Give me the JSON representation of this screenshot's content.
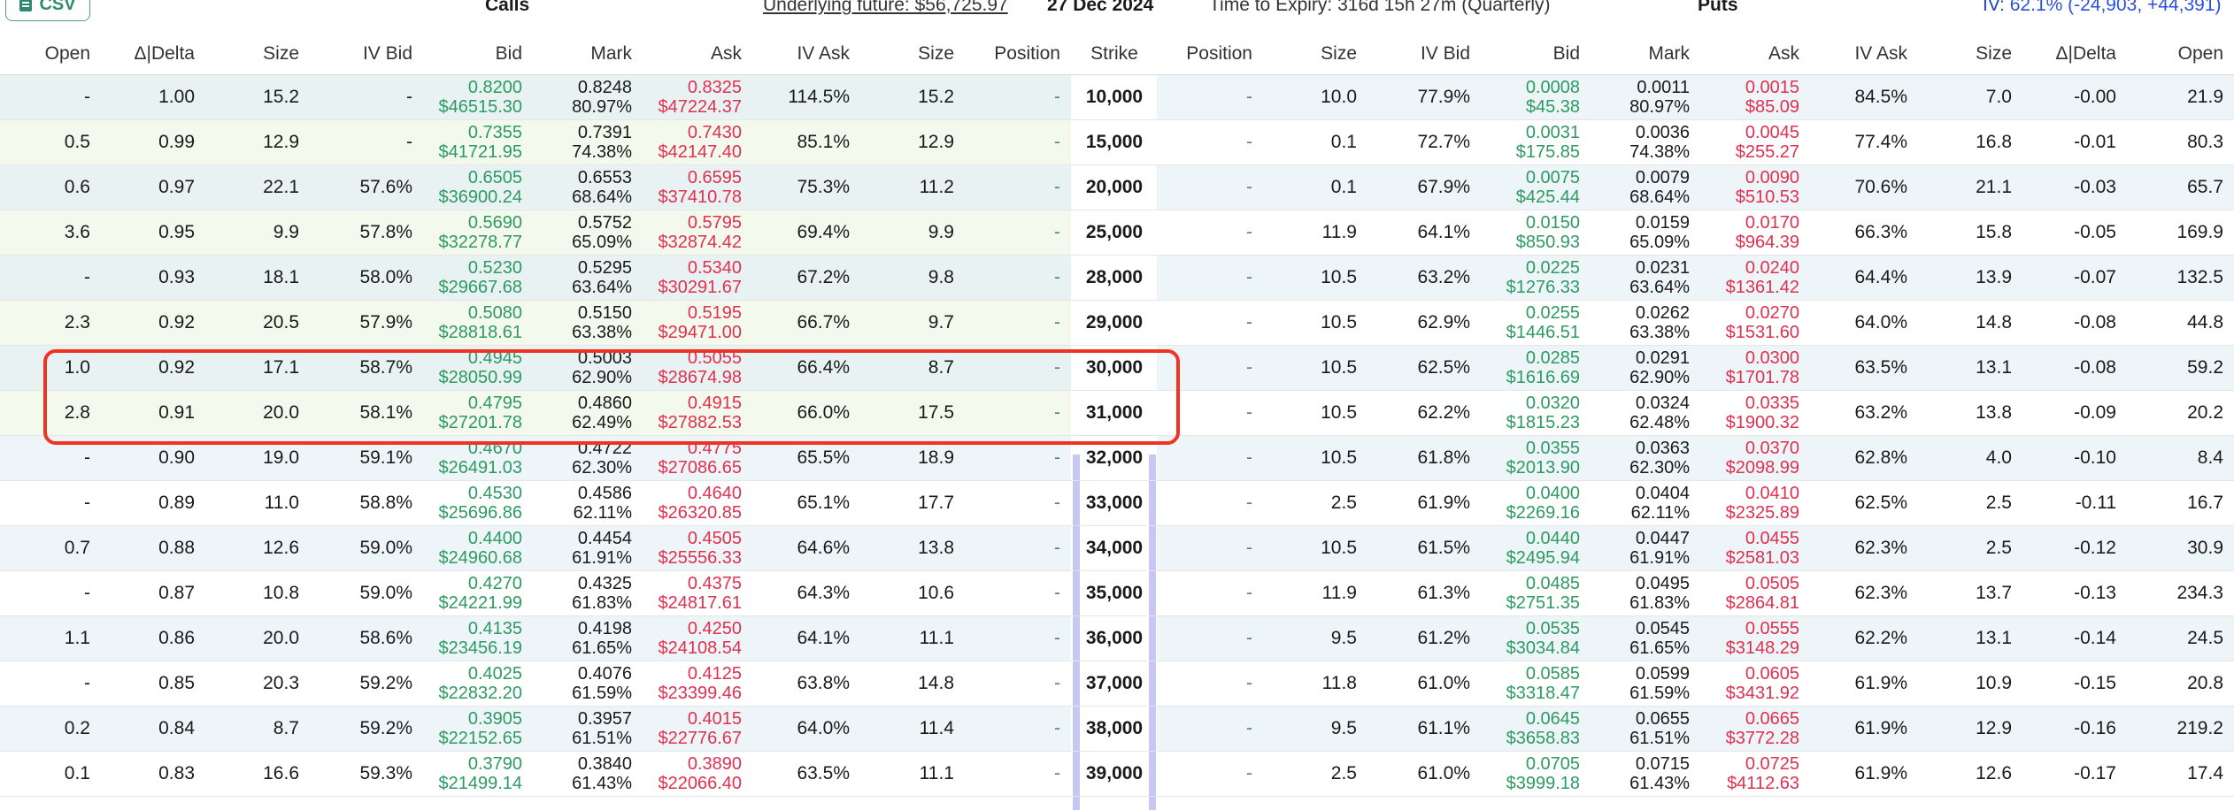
{
  "toolbar": {
    "csv_label": "CSV",
    "calls_title": "Calls",
    "underlying_future": "Underlying future: $56,725.97",
    "expiry_date": "27 Dec 2024",
    "time_to_expiry": "Time to Expiry: 316d 15h 27m (Quarterly)",
    "puts_title": "Puts",
    "iv_label": "IV:",
    "iv_value": "62.1% (-24,903, +44,391)"
  },
  "columns": {
    "calls": [
      "Open",
      "Δ|Delta",
      "Size",
      "IV Bid",
      "Bid",
      "Mark",
      "Ask",
      "IV Ask",
      "Size",
      "Position"
    ],
    "strike": "Strike",
    "puts": [
      "Position",
      "Size",
      "IV Bid",
      "Bid",
      "Mark",
      "Ask",
      "IV Ask",
      "Size",
      "Δ|Delta",
      "Open"
    ]
  },
  "rows": [
    {
      "strike": "10,000",
      "calls": {
        "open": "-",
        "delta": "1.00",
        "size": "15.2",
        "iv_bid": "-",
        "bid": "0.8200",
        "bid_usd": "$46515.30",
        "mark": "0.8248",
        "mark_pct": "80.97%",
        "ask": "0.8325",
        "ask_usd": "$47224.37",
        "iv_ask": "114.5%",
        "ask_size": "15.2",
        "position": "-"
      },
      "puts": {
        "position": "-",
        "size": "10.0",
        "iv_bid": "77.9%",
        "bid": "0.0008",
        "bid_usd": "$45.38",
        "mark": "0.0011",
        "mark_pct": "80.97%",
        "ask": "0.0015",
        "ask_usd": "$85.09",
        "iv_ask": "84.5%",
        "ask_size": "7.0",
        "delta": "-0.00",
        "open": "21.9"
      }
    },
    {
      "strike": "15,000",
      "calls": {
        "open": "0.5",
        "delta": "0.99",
        "size": "12.9",
        "iv_bid": "-",
        "bid": "0.7355",
        "bid_usd": "$41721.95",
        "mark": "0.7391",
        "mark_pct": "74.38%",
        "ask": "0.7430",
        "ask_usd": "$42147.40",
        "iv_ask": "85.1%",
        "ask_size": "12.9",
        "position": "-"
      },
      "puts": {
        "position": "-",
        "size": "0.1",
        "iv_bid": "72.7%",
        "bid": "0.0031",
        "bid_usd": "$175.85",
        "mark": "0.0036",
        "mark_pct": "74.38%",
        "ask": "0.0045",
        "ask_usd": "$255.27",
        "iv_ask": "77.4%",
        "ask_size": "16.8",
        "delta": "-0.01",
        "open": "80.3"
      }
    },
    {
      "strike": "20,000",
      "calls": {
        "open": "0.6",
        "delta": "0.97",
        "size": "22.1",
        "iv_bid": "57.6%",
        "bid": "0.6505",
        "bid_usd": "$36900.24",
        "mark": "0.6553",
        "mark_pct": "68.64%",
        "ask": "0.6595",
        "ask_usd": "$37410.78",
        "iv_ask": "75.3%",
        "ask_size": "11.2",
        "position": "-"
      },
      "puts": {
        "position": "-",
        "size": "0.1",
        "iv_bid": "67.9%",
        "bid": "0.0075",
        "bid_usd": "$425.44",
        "mark": "0.0079",
        "mark_pct": "68.64%",
        "ask": "0.0090",
        "ask_usd": "$510.53",
        "iv_ask": "70.6%",
        "ask_size": "21.1",
        "delta": "-0.03",
        "open": "65.7"
      }
    },
    {
      "strike": "25,000",
      "calls": {
        "open": "3.6",
        "delta": "0.95",
        "size": "9.9",
        "iv_bid": "57.8%",
        "bid": "0.5690",
        "bid_usd": "$32278.77",
        "mark": "0.5752",
        "mark_pct": "65.09%",
        "ask": "0.5795",
        "ask_usd": "$32874.42",
        "iv_ask": "69.4%",
        "ask_size": "9.9",
        "position": "-"
      },
      "puts": {
        "position": "-",
        "size": "11.9",
        "iv_bid": "64.1%",
        "bid": "0.0150",
        "bid_usd": "$850.93",
        "mark": "0.0159",
        "mark_pct": "65.09%",
        "ask": "0.0170",
        "ask_usd": "$964.39",
        "iv_ask": "66.3%",
        "ask_size": "15.8",
        "delta": "-0.05",
        "open": "169.9"
      }
    },
    {
      "strike": "28,000",
      "calls": {
        "open": "-",
        "delta": "0.93",
        "size": "18.1",
        "iv_bid": "58.0%",
        "bid": "0.5230",
        "bid_usd": "$29667.68",
        "mark": "0.5295",
        "mark_pct": "63.64%",
        "ask": "0.5340",
        "ask_usd": "$30291.67",
        "iv_ask": "67.2%",
        "ask_size": "9.8",
        "position": "-"
      },
      "puts": {
        "position": "-",
        "size": "10.5",
        "iv_bid": "63.2%",
        "bid": "0.0225",
        "bid_usd": "$1276.33",
        "mark": "0.0231",
        "mark_pct": "63.64%",
        "ask": "0.0240",
        "ask_usd": "$1361.42",
        "iv_ask": "64.4%",
        "ask_size": "13.9",
        "delta": "-0.07",
        "open": "132.5"
      }
    },
    {
      "strike": "29,000",
      "calls": {
        "open": "2.3",
        "delta": "0.92",
        "size": "20.5",
        "iv_bid": "57.9%",
        "bid": "0.5080",
        "bid_usd": "$28818.61",
        "mark": "0.5150",
        "mark_pct": "63.38%",
        "ask": "0.5195",
        "ask_usd": "$29471.00",
        "iv_ask": "66.7%",
        "ask_size": "9.7",
        "position": "-"
      },
      "puts": {
        "position": "-",
        "size": "10.5",
        "iv_bid": "62.9%",
        "bid": "0.0255",
        "bid_usd": "$1446.51",
        "mark": "0.0262",
        "mark_pct": "63.38%",
        "ask": "0.0270",
        "ask_usd": "$1531.60",
        "iv_ask": "64.0%",
        "ask_size": "14.8",
        "delta": "-0.08",
        "open": "44.8"
      }
    },
    {
      "strike": "30,000",
      "calls": {
        "open": "1.0",
        "delta": "0.92",
        "size": "17.1",
        "iv_bid": "58.7%",
        "bid": "0.4945",
        "bid_usd": "$28050.99",
        "mark": "0.5003",
        "mark_pct": "62.90%",
        "ask": "0.5055",
        "ask_usd": "$28674.98",
        "iv_ask": "66.4%",
        "ask_size": "8.7",
        "position": "-"
      },
      "puts": {
        "position": "-",
        "size": "10.5",
        "iv_bid": "62.5%",
        "bid": "0.0285",
        "bid_usd": "$1616.69",
        "mark": "0.0291",
        "mark_pct": "62.90%",
        "ask": "0.0300",
        "ask_usd": "$1701.78",
        "iv_ask": "63.5%",
        "ask_size": "13.1",
        "delta": "-0.08",
        "open": "59.2"
      }
    },
    {
      "strike": "31,000",
      "calls": {
        "open": "2.8",
        "delta": "0.91",
        "size": "20.0",
        "iv_bid": "58.1%",
        "bid": "0.4795",
        "bid_usd": "$27201.78",
        "mark": "0.4860",
        "mark_pct": "62.49%",
        "ask": "0.4915",
        "ask_usd": "$27882.53",
        "iv_ask": "66.0%",
        "ask_size": "17.5",
        "position": "-"
      },
      "puts": {
        "position": "-",
        "size": "10.5",
        "iv_bid": "62.2%",
        "bid": "0.0320",
        "bid_usd": "$1815.23",
        "mark": "0.0324",
        "mark_pct": "62.48%",
        "ask": "0.0335",
        "ask_usd": "$1900.32",
        "iv_ask": "63.2%",
        "ask_size": "13.8",
        "delta": "-0.09",
        "open": "20.2"
      }
    },
    {
      "strike": "32,000",
      "calls": {
        "open": "-",
        "delta": "0.90",
        "size": "19.0",
        "iv_bid": "59.1%",
        "bid": "0.4670",
        "bid_usd": "$26491.03",
        "mark": "0.4722",
        "mark_pct": "62.30%",
        "ask": "0.4775",
        "ask_usd": "$27086.65",
        "iv_ask": "65.5%",
        "ask_size": "18.9",
        "position": "-"
      },
      "puts": {
        "position": "-",
        "size": "10.5",
        "iv_bid": "61.8%",
        "bid": "0.0355",
        "bid_usd": "$2013.90",
        "mark": "0.0363",
        "mark_pct": "62.30%",
        "ask": "0.0370",
        "ask_usd": "$2098.99",
        "iv_ask": "62.8%",
        "ask_size": "4.0",
        "delta": "-0.10",
        "open": "8.4"
      }
    },
    {
      "strike": "33,000",
      "calls": {
        "open": "-",
        "delta": "0.89",
        "size": "11.0",
        "iv_bid": "58.8%",
        "bid": "0.4530",
        "bid_usd": "$25696.86",
        "mark": "0.4586",
        "mark_pct": "62.11%",
        "ask": "0.4640",
        "ask_usd": "$26320.85",
        "iv_ask": "65.1%",
        "ask_size": "17.7",
        "position": "-"
      },
      "puts": {
        "position": "-",
        "size": "2.5",
        "iv_bid": "61.9%",
        "bid": "0.0400",
        "bid_usd": "$2269.16",
        "mark": "0.0404",
        "mark_pct": "62.11%",
        "ask": "0.0410",
        "ask_usd": "$2325.89",
        "iv_ask": "62.5%",
        "ask_size": "2.5",
        "delta": "-0.11",
        "open": "16.7"
      }
    },
    {
      "strike": "34,000",
      "calls": {
        "open": "0.7",
        "delta": "0.88",
        "size": "12.6",
        "iv_bid": "59.0%",
        "bid": "0.4400",
        "bid_usd": "$24960.68",
        "mark": "0.4454",
        "mark_pct": "61.91%",
        "ask": "0.4505",
        "ask_usd": "$25556.33",
        "iv_ask": "64.6%",
        "ask_size": "13.8",
        "position": "-"
      },
      "puts": {
        "position": "-",
        "size": "10.5",
        "iv_bid": "61.5%",
        "bid": "0.0440",
        "bid_usd": "$2495.94",
        "mark": "0.0447",
        "mark_pct": "61.91%",
        "ask": "0.0455",
        "ask_usd": "$2581.03",
        "iv_ask": "62.3%",
        "ask_size": "2.5",
        "delta": "-0.12",
        "open": "30.9"
      }
    },
    {
      "strike": "35,000",
      "calls": {
        "open": "-",
        "delta": "0.87",
        "size": "10.8",
        "iv_bid": "59.0%",
        "bid": "0.4270",
        "bid_usd": "$24221.99",
        "mark": "0.4325",
        "mark_pct": "61.83%",
        "ask": "0.4375",
        "ask_usd": "$24817.61",
        "iv_ask": "64.3%",
        "ask_size": "10.6",
        "position": "-"
      },
      "puts": {
        "position": "-",
        "size": "11.9",
        "iv_bid": "61.3%",
        "bid": "0.0485",
        "bid_usd": "$2751.35",
        "mark": "0.0495",
        "mark_pct": "61.83%",
        "ask": "0.0505",
        "ask_usd": "$2864.81",
        "iv_ask": "62.3%",
        "ask_size": "13.7",
        "delta": "-0.13",
        "open": "234.3"
      }
    },
    {
      "strike": "36,000",
      "calls": {
        "open": "1.1",
        "delta": "0.86",
        "size": "20.0",
        "iv_bid": "58.6%",
        "bid": "0.4135",
        "bid_usd": "$23456.19",
        "mark": "0.4198",
        "mark_pct": "61.65%",
        "ask": "0.4250",
        "ask_usd": "$24108.54",
        "iv_ask": "64.1%",
        "ask_size": "11.1",
        "position": "-"
      },
      "puts": {
        "position": "-",
        "size": "9.5",
        "iv_bid": "61.2%",
        "bid": "0.0535",
        "bid_usd": "$3034.84",
        "mark": "0.0545",
        "mark_pct": "61.65%",
        "ask": "0.0555",
        "ask_usd": "$3148.29",
        "iv_ask": "62.2%",
        "ask_size": "13.1",
        "delta": "-0.14",
        "open": "24.5"
      }
    },
    {
      "strike": "37,000",
      "calls": {
        "open": "-",
        "delta": "0.85",
        "size": "20.3",
        "iv_bid": "59.2%",
        "bid": "0.4025",
        "bid_usd": "$22832.20",
        "mark": "0.4076",
        "mark_pct": "61.59%",
        "ask": "0.4125",
        "ask_usd": "$23399.46",
        "iv_ask": "63.8%",
        "ask_size": "14.8",
        "position": "-"
      },
      "puts": {
        "position": "-",
        "size": "11.8",
        "iv_bid": "61.0%",
        "bid": "0.0585",
        "bid_usd": "$3318.47",
        "mark": "0.0599",
        "mark_pct": "61.59%",
        "ask": "0.0605",
        "ask_usd": "$3431.92",
        "iv_ask": "61.9%",
        "ask_size": "10.9",
        "delta": "-0.15",
        "open": "20.8"
      }
    },
    {
      "strike": "38,000",
      "calls": {
        "open": "0.2",
        "delta": "0.84",
        "size": "8.7",
        "iv_bid": "59.2%",
        "bid": "0.3905",
        "bid_usd": "$22152.65",
        "mark": "0.3957",
        "mark_pct": "61.51%",
        "ask": "0.4015",
        "ask_usd": "$22776.67",
        "iv_ask": "64.0%",
        "ask_size": "11.4",
        "position": "-"
      },
      "puts": {
        "position": "-",
        "size": "9.5",
        "iv_bid": "61.1%",
        "bid": "0.0645",
        "bid_usd": "$3658.83",
        "mark": "0.0655",
        "mark_pct": "61.51%",
        "ask": "0.0665",
        "ask_usd": "$3772.28",
        "iv_ask": "61.9%",
        "ask_size": "12.9",
        "delta": "-0.16",
        "open": "219.2"
      }
    },
    {
      "strike": "39,000",
      "calls": {
        "open": "0.1",
        "delta": "0.83",
        "size": "16.6",
        "iv_bid": "59.3%",
        "bid": "0.3790",
        "bid_usd": "$21499.14",
        "mark": "0.3840",
        "mark_pct": "61.43%",
        "ask": "0.3890",
        "ask_usd": "$22066.40",
        "iv_ask": "63.5%",
        "ask_size": "11.1",
        "position": "-"
      },
      "puts": {
        "position": "-",
        "size": "2.5",
        "iv_bid": "61.0%",
        "bid": "0.0705",
        "bid_usd": "$3999.18",
        "mark": "0.0715",
        "mark_pct": "61.43%",
        "ask": "0.0725",
        "ask_usd": "$4112.63",
        "iv_ask": "61.9%",
        "ask_size": "12.6",
        "delta": "-0.17",
        "open": "17.4"
      }
    }
  ],
  "colors": {
    "bid": "#2d9a62",
    "ask": "#e0304f",
    "highlight_border": "#ee3322",
    "strike_bar": "#c6c8f2",
    "itm_call_bg": "#f3f9ec",
    "itm_call_bg_alt": "#e9f2f3",
    "row_bg": "#ffffff",
    "row_bg_alt": "#eef5f8"
  },
  "highlight": {
    "strikes": [
      "30,000",
      "31,000"
    ]
  }
}
